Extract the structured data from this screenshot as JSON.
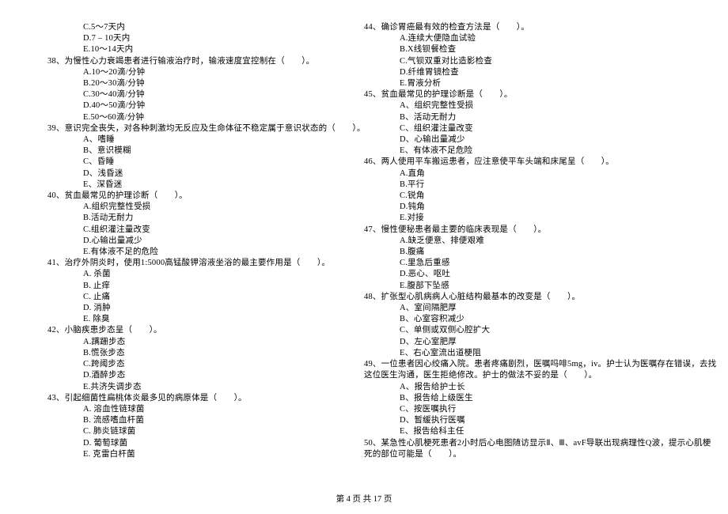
{
  "leftColumn": {
    "preOptions": [
      "C.5～7天内",
      "D.7 – 10天内",
      "E.10～14天内"
    ],
    "questions": [
      {
        "num": "38",
        "stem": "、为慢性心力衰竭患者进行输液治疗时，输液速度宜控制在（　　）。",
        "options": [
          "A.10～20滴/分钟",
          "B.20～30滴/分钟",
          "C.30～40滴/分钟",
          "D.40～50滴/分钟",
          "E.50～60滴/分钟"
        ]
      },
      {
        "num": "39",
        "stem": "、意识完全丧失，对各种刺激均无反应及生命体征不稳定属于意识状态的（　　）。",
        "options": [
          "A、嗜睡",
          "B、意识模糊",
          "C、昏睡",
          "D、浅昏迷",
          "E、深昏迷"
        ]
      },
      {
        "num": "40",
        "stem": "、贫血最常见的护理诊断（　　）。",
        "options": [
          "A.组织完整性受损",
          "B.活动无耐力",
          "C.组织灌注量改变",
          "D.心输出量减少",
          "E.有体液不足的危险"
        ]
      },
      {
        "num": "41",
        "stem": "、治疗外阴炎时，使用1:5000高锰酸钾溶液坐浴的最主要作用是（　　）。",
        "options": [
          "A. 杀菌",
          "B. 止痒",
          "C. 止痛",
          "D. 消肿",
          "E. 除臭"
        ]
      },
      {
        "num": "42",
        "stem": "、小脑疾患步态呈（　　）。",
        "options": [
          "A.蹒跚步态",
          "B.慌张步态",
          "C.跨阈步态",
          "D.酒醉步态",
          "E.共济失调步态"
        ]
      },
      {
        "num": "43",
        "stem": "、引起细菌性扁桃体炎最多见的病原体是（　　）。",
        "options": [
          "A. 溶血性链球菌",
          "B. 流感嗜血杆菌",
          "C. 肺炎链球菌",
          "D. 葡萄球菌",
          "E. 克雷白杆菌"
        ]
      }
    ]
  },
  "rightColumn": {
    "questions": [
      {
        "num": "44",
        "stem": "、确诊胃癌最有效的检查方法是（　　）。",
        "options": [
          "A.连续大便隐血试验",
          "B.X线钡餐检查",
          "C.气钡双重对比造影检查",
          "D.纤维胃镜检查",
          "E.胃液分析"
        ]
      },
      {
        "num": "45",
        "stem": "、贫血最常见的护理诊断是（　　）。",
        "options": [
          "A、组织完整性受损",
          "B、活动无耐力",
          "C、组织灌注量改变",
          "D、心输出量减少",
          "E、有体液不足危险"
        ]
      },
      {
        "num": "46",
        "stem": "、两人使用平车搬运患者，应注意使平车头端和床尾呈（　　）。",
        "options": [
          "A.直角",
          "B.平行",
          "C.锐角",
          "D.钝角",
          "E.对接"
        ]
      },
      {
        "num": "47",
        "stem": "、慢性便秘患者最主要的临床表现是（　　）。",
        "options": [
          "A.缺乏便意、排便艰难",
          "B.腹痛",
          "C.里急后重感",
          "D.恶心、呕吐",
          "E.腹部下坠感"
        ]
      },
      {
        "num": "48",
        "stem": "、扩张型心肌病病人心脏结构最基本的改变是（　　）。",
        "options": [
          "A、室间隔肥厚",
          "B、心室容积减少",
          "C、单侧或双侧心腔扩大",
          "D、左心室肥厚",
          "E、右心室流出道梗阻"
        ]
      },
      {
        "num": "49",
        "stem1": "、一位患者因心绞痛入院。患者疼痛剧烈，医嘱吗啡5mg，iv。护士认为医嘱存在错误，去找",
        "stem2": "这位医生沟通，医生拒绝修改。护士的做法不妥的是（　　）。",
        "options": [
          "A、报告给护士长",
          "B、报告给上级医生",
          "C、按医嘱执行",
          "D、暂缓执行医嘱",
          "E、报告给科主任"
        ]
      },
      {
        "num": "50",
        "stem1": "、某急性心肌梗死患者2小时后心电图随访显示Ⅱ、Ⅲ、avF导联出现病理性Q波，提示心肌梗",
        "stem2": "死的部位可能是（　　）。",
        "options": []
      }
    ]
  },
  "footer": "第 4 页 共 17 页"
}
